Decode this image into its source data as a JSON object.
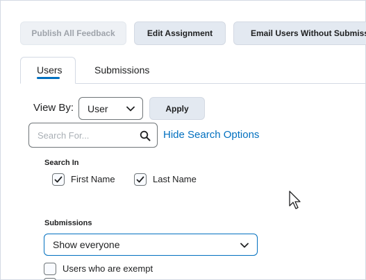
{
  "toolbar": {
    "publish_all_feedback": "Publish All Feedback",
    "edit_assignment": "Edit Assignment",
    "email_users_without_submission": "Email Users Without Submission"
  },
  "tabs": [
    {
      "label": "Users",
      "active": true
    },
    {
      "label": "Submissions",
      "active": false
    }
  ],
  "view_by": {
    "label": "View By:",
    "selected": "User",
    "apply_label": "Apply"
  },
  "search": {
    "placeholder": "Search For...",
    "hide_options_link": "Hide Search Options"
  },
  "search_in": {
    "title": "Search In",
    "options": [
      {
        "label": "First Name",
        "checked": true
      },
      {
        "label": "Last Name",
        "checked": true
      }
    ]
  },
  "submissions_filter": {
    "title": "Submissions",
    "selected": "Show everyone",
    "exempt_label": "Users who are exempt",
    "exempt_checked": false
  },
  "colors": {
    "accent": "#006fbf",
    "button_bg": "#e3e9f1",
    "border": "#d3d9e3"
  },
  "icons": [
    "search-icon",
    "chevron-down-icon",
    "checkmark-icon",
    "mouse-cursor-icon"
  ]
}
